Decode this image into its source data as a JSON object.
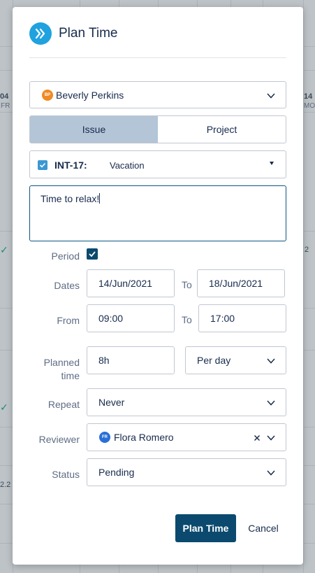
{
  "background": {
    "col_left_day": "04",
    "col_left_weekday": "FR",
    "col_right_day": "14",
    "col_right_weekday": "MO",
    "right_value": "2",
    "left_value": "2.2"
  },
  "dialog": {
    "title": "Plan Time",
    "logo_icon": "double-chevron-right-icon",
    "accent_color": "#1fa2df"
  },
  "assignee": {
    "initials": "BP",
    "name": "Beverly Perkins",
    "avatar_color": "#f08a24"
  },
  "type_toggle": {
    "options": [
      "Issue",
      "Project"
    ],
    "selected": "Issue"
  },
  "issue": {
    "key": "INT-17:",
    "summary": "Vacation",
    "checked": true
  },
  "description": {
    "value": "Time to relax!"
  },
  "form": {
    "period_label": "Period",
    "period_checked": true,
    "dates_label": "Dates",
    "start_date": "14/Jun/2021",
    "to_label": "To",
    "end_date": "18/Jun/2021",
    "from_label": "From",
    "start_time": "09:00",
    "end_time": "17:00",
    "planned_label_line1": "Planned",
    "planned_label_line2": "time",
    "planned_value": "8h",
    "planned_unit": "Per day",
    "repeat_label": "Repeat",
    "repeat_value": "Never",
    "reviewer_label": "Reviewer",
    "reviewer_initials": "FR",
    "reviewer_name": "Flora Romero",
    "reviewer_avatar_color": "#2a6fd6",
    "status_label": "Status",
    "status_value": "Pending"
  },
  "actions": {
    "submit_label": "Plan Time",
    "cancel_label": "Cancel",
    "primary_color": "#0b4a6e"
  }
}
